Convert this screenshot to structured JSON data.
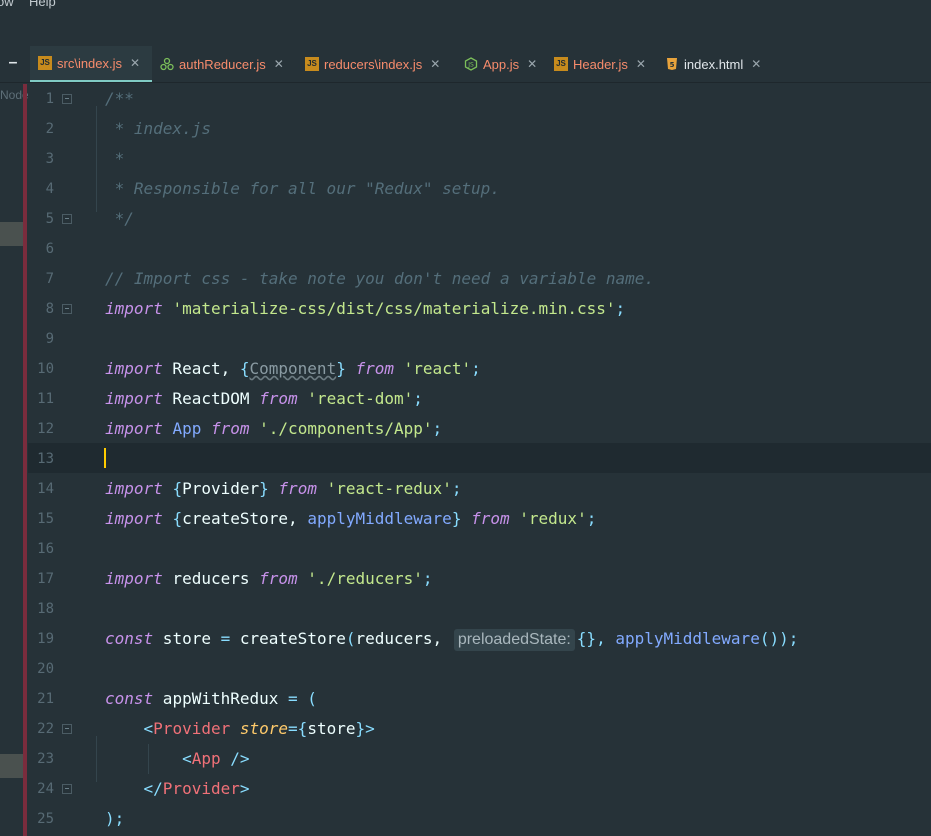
{
  "menu": {
    "items": [
      "ow",
      "Help"
    ]
  },
  "tabs": [
    {
      "label": "src\\index.js",
      "icon": "js-file-icon",
      "active": true,
      "color": "#f78c6c"
    },
    {
      "label": "authReducer.js",
      "icon": "redux-icon",
      "active": false,
      "color": "#f78c6c"
    },
    {
      "label": "reducers\\index.js",
      "icon": "js-file-icon",
      "active": false,
      "color": "#f78c6c"
    },
    {
      "label": "App.js",
      "icon": "nodejs-icon",
      "active": false,
      "color": "#f78c6c"
    },
    {
      "label": "Header.js",
      "icon": "js-file-icon",
      "active": false,
      "color": "#f78c6c"
    },
    {
      "label": "index.html",
      "icon": "html5-icon",
      "active": false,
      "color": "#e0e6ea"
    }
  ],
  "sidebar": {
    "label": "Node"
  },
  "editor": {
    "current_line": 13,
    "line_numbers": [
      "1",
      "2",
      "3",
      "4",
      "5",
      "6",
      "7",
      "8",
      "9",
      "10",
      "11",
      "12",
      "13",
      "14",
      "15",
      "16",
      "17",
      "18",
      "19",
      "20",
      "21",
      "22",
      "23",
      "24",
      "25"
    ],
    "lines": [
      [
        [
          "cm",
          "/**"
        ]
      ],
      [
        [
          "cm",
          " * index.js"
        ]
      ],
      [
        [
          "cm",
          " *"
        ]
      ],
      [
        [
          "cm",
          " * Responsible for all our \"Redux\" setup."
        ]
      ],
      [
        [
          "cm",
          " */"
        ]
      ],
      [],
      [
        [
          "cm",
          "// Import css - take note you don't need a variable name."
        ]
      ],
      [
        [
          "kw",
          "import"
        ],
        [
          "sp",
          " "
        ],
        [
          "str",
          "'materialize-css/dist/css/materialize.min.css'"
        ],
        [
          "pn",
          ";"
        ]
      ],
      [],
      [
        [
          "kw",
          "import"
        ],
        [
          "id",
          " React, "
        ],
        [
          "pn",
          "{"
        ],
        [
          "unused",
          "Component"
        ],
        [
          "pn",
          "}"
        ],
        [
          "sp",
          " "
        ],
        [
          "kw",
          "from"
        ],
        [
          "sp",
          " "
        ],
        [
          "str",
          "'react'"
        ],
        [
          "pn",
          ";"
        ]
      ],
      [
        [
          "kw",
          "import"
        ],
        [
          "id",
          " ReactDOM "
        ],
        [
          "kw",
          "from"
        ],
        [
          "sp",
          " "
        ],
        [
          "str",
          "'react-dom'"
        ],
        [
          "pn",
          ";"
        ]
      ],
      [
        [
          "kw",
          "import"
        ],
        [
          "sp",
          " "
        ],
        [
          "fn",
          "App"
        ],
        [
          "sp",
          " "
        ],
        [
          "kw",
          "from"
        ],
        [
          "sp",
          " "
        ],
        [
          "str",
          "'./components/App'"
        ],
        [
          "pn",
          ";"
        ]
      ],
      [],
      [
        [
          "kw",
          "import"
        ],
        [
          "sp",
          " "
        ],
        [
          "pn",
          "{"
        ],
        [
          "id",
          "Provider"
        ],
        [
          "pn",
          "}"
        ],
        [
          "sp",
          " "
        ],
        [
          "kw",
          "from"
        ],
        [
          "sp",
          " "
        ],
        [
          "str",
          "'react-redux'"
        ],
        [
          "pn",
          ";"
        ]
      ],
      [
        [
          "kw",
          "import"
        ],
        [
          "sp",
          " "
        ],
        [
          "pn",
          "{"
        ],
        [
          "id",
          "createStore, "
        ],
        [
          "fn",
          "applyMiddleware"
        ],
        [
          "pn",
          "}"
        ],
        [
          "sp",
          " "
        ],
        [
          "kw",
          "from"
        ],
        [
          "sp",
          " "
        ],
        [
          "str",
          "'redux'"
        ],
        [
          "pn",
          ";"
        ]
      ],
      [],
      [
        [
          "kw",
          "import"
        ],
        [
          "id",
          " reducers "
        ],
        [
          "kw",
          "from"
        ],
        [
          "sp",
          " "
        ],
        [
          "str",
          "'./reducers'"
        ],
        [
          "pn",
          ";"
        ]
      ],
      [],
      [
        [
          "kw",
          "const"
        ],
        [
          "id",
          " store "
        ],
        [
          "pn",
          "="
        ],
        [
          "id",
          " createStore"
        ],
        [
          "pn",
          "("
        ],
        [
          "id",
          "reducers, "
        ],
        [
          "hint",
          "preloadedState:"
        ],
        [
          "pn",
          "{}, "
        ],
        [
          "fn",
          "applyMiddleware"
        ],
        [
          "pn",
          "());"
        ]
      ],
      [],
      [
        [
          "kw",
          "const"
        ],
        [
          "id",
          " appWithRedux "
        ],
        [
          "pn",
          "= ("
        ]
      ],
      [
        [
          "sp",
          "    "
        ],
        [
          "pn",
          "<"
        ],
        [
          "tag",
          "Provider"
        ],
        [
          "sp",
          " "
        ],
        [
          "attr",
          "store"
        ],
        [
          "pn",
          "={"
        ],
        [
          "id",
          "store"
        ],
        [
          "pn",
          "}>"
        ]
      ],
      [
        [
          "sp",
          "        "
        ],
        [
          "pn",
          "<"
        ],
        [
          "tag",
          "App"
        ],
        [
          "sp",
          " "
        ],
        [
          "pn",
          "/>"
        ]
      ],
      [
        [
          "sp",
          "    "
        ],
        [
          "pn",
          "</"
        ],
        [
          "tag",
          "Provider"
        ],
        [
          "pn",
          ">"
        ]
      ],
      [
        [
          "pn",
          ");"
        ]
      ]
    ]
  }
}
